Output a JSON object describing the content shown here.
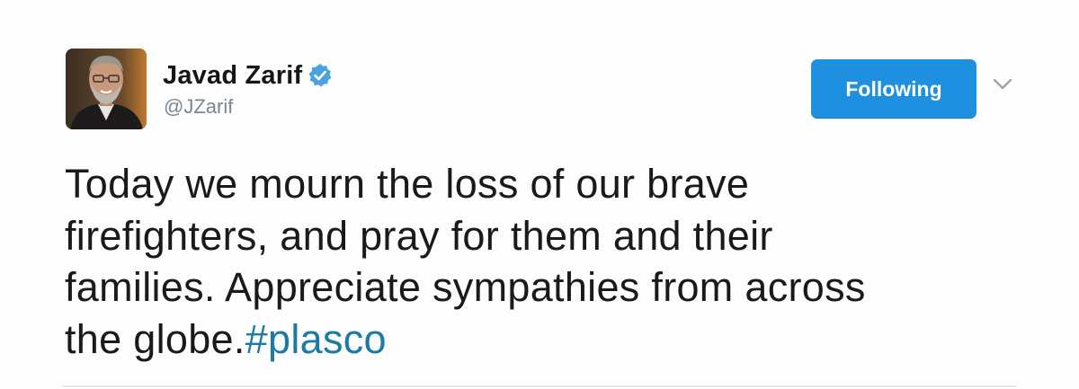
{
  "user": {
    "display_name": "Javad Zarif",
    "handle": "@JZarif",
    "verified": true,
    "avatar_icon": "profile-photo"
  },
  "follow_button": {
    "label": "Following"
  },
  "menu_icon": "chevron-down-icon",
  "tweet": {
    "lines": [
      "Today we mourn the loss of our brave",
      "firefighters, and pray for them and their",
      "families. Appreciate sympathies from across"
    ],
    "last_line_text": "the globe.",
    "hashtag": "#plasco"
  },
  "colors": {
    "accent_blue": "#1f8fe0",
    "hashtag": "#1b7ba3",
    "handle_gray": "#7a8590",
    "verified_blue": "#4aa3df"
  }
}
